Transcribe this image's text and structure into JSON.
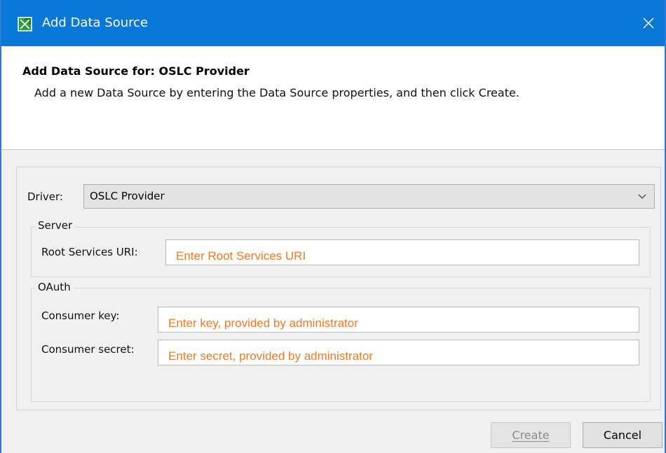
{
  "window": {
    "title": "Add Data Source",
    "close_glyph": "✕",
    "accent_color": "#0a78d7"
  },
  "header": {
    "title": "Add Data Source for: OSLC Provider",
    "description": "Add a new Data Source by entering the Data Source properties, and then click Create."
  },
  "form": {
    "driver_label": "Driver:",
    "driver_value": "OSLC Provider",
    "server": {
      "group_label": "Server",
      "root_uri_label": "Root Services URI:",
      "root_uri_placeholder": "Enter Root Services URI"
    },
    "oauth": {
      "group_label": "OAuth",
      "consumer_key_label": "Consumer key:",
      "consumer_key_placeholder": "Enter key, provided by administrator",
      "consumer_secret_label": "Consumer secret:",
      "consumer_secret_placeholder": "Enter secret, provided by administrator"
    },
    "placeholder_color": "#f5781e"
  },
  "buttons": {
    "create_label": "Create",
    "cancel_label": "Cancel"
  },
  "icons": {
    "app": "data-source-app-icon",
    "close": "close-icon",
    "dropdown": "chevron-down-icon"
  }
}
